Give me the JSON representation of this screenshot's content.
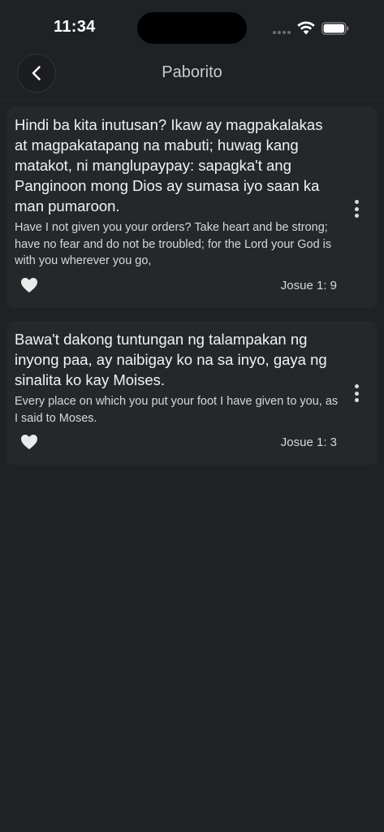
{
  "status_bar": {
    "time": "11:34"
  },
  "nav": {
    "title": "Paborito",
    "back_icon": "chevron-left-icon"
  },
  "favorites": [
    {
      "tagalog": "Hindi ba kita inutusan? Ikaw ay magpakalakas at magpakatapang na mabuti; huwag kang matakot, ni manglupaypay: sapagka't ang Panginoon mong Dios ay sumasa iyo saan ka man pumaroon.",
      "english": "Have I not given you your orders? Take heart and be strong; have no fear and do not be troubled; for the Lord your God is with you wherever you go,",
      "reference": "Josue 1: 9"
    },
    {
      "tagalog": "Bawa't dakong tuntungan ng talampakan ng inyong paa, ay naibigay ko na sa inyo, gaya ng sinalita ko kay Moises.",
      "english": "Every place on which you put your foot I have given to you, as I said to Moses.",
      "reference": "Josue 1: 3"
    }
  ],
  "colors": {
    "background": "#1f2225",
    "card": "#25282b",
    "text": "#f2f2f2",
    "secondary_text": "#d6d7d8"
  }
}
